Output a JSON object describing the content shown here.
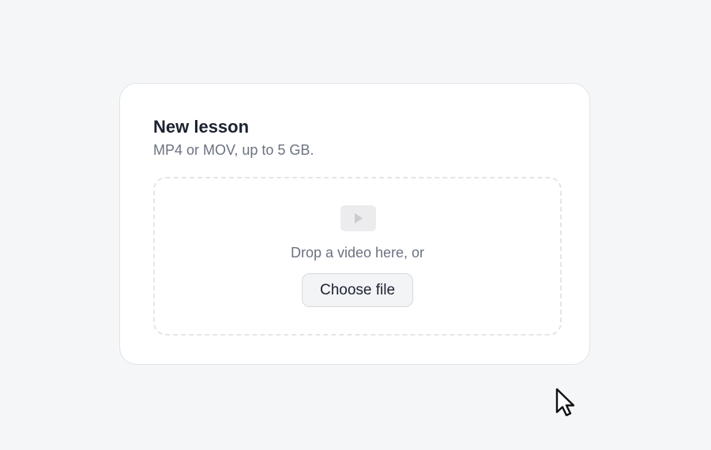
{
  "card": {
    "title": "New lesson",
    "subtitle": "MP4 or MOV, up to 5 GB."
  },
  "dropzone": {
    "icon": "video-play-icon",
    "prompt": "Drop a video here, or",
    "choose_label": "Choose file"
  },
  "colors": {
    "background": "#f5f6f8",
    "card": "#ffffff",
    "title_text": "#1c2230",
    "muted_text": "#6b7280",
    "dashed_border": "#e3e5ea",
    "button_bg": "#f3f4f6"
  },
  "cursor": {
    "icon": "mouse-pointer-icon"
  }
}
